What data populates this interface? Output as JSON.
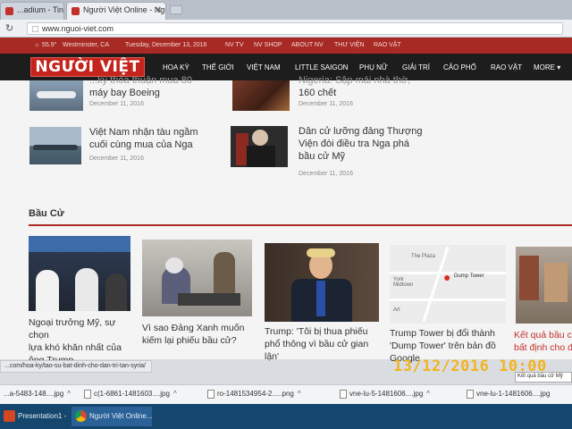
{
  "browser": {
    "tabs": [
      {
        "label": "...adium - Tin Ti..."
      },
      {
        "label": "Người Việt Online - Ngu..."
      }
    ],
    "url": "www.nguoi-viet.com"
  },
  "topbar": {
    "weather": "55.9°",
    "location": "Westminster, CA",
    "date": "Tuesday, December 13, 2016",
    "links": [
      "NV TV",
      "NV SHOP",
      "ABOUT NV",
      "THƯ VIỆN",
      "RAO VẶT"
    ]
  },
  "site": {
    "logo": "NGƯỜI VIỆT",
    "nav": [
      "HOA KỲ",
      "THẾ GIỚI",
      "VIỆT NAM",
      "LITTLE SAIGON",
      "PHỤ NỮ",
      "GIẢI TRÍ",
      "CẢO PHỐ",
      "RAO VẶT",
      "MORE ▾"
    ]
  },
  "top_stories": [
    {
      "title_partial": "...ký thỏa thuận mua 80",
      "title_line2": "máy bay Boeing",
      "date": "December 11, 2016"
    },
    {
      "title_partial": "Nigeria: Sập mái nhà thờ,",
      "title_line2": "160 chết",
      "date": "December 11, 2016"
    },
    {
      "title_line1": "Việt Nam nhận tàu ngầm",
      "title_line2": "cuối cùng mua của Nga",
      "date": "December 11, 2016"
    },
    {
      "title_line1": "Dân cử lưỡng đảng Thượng",
      "title_line2": "Viện đòi điều tra Nga phá",
      "title_line3": "bầu cử Mỹ",
      "date": "December 11, 2016"
    }
  ],
  "section": {
    "title": "Bầu Cử",
    "cards": [
      {
        "lines": [
          "Ngoại trưởng Mỹ, sự chọn",
          "lựa khó khăn nhất của",
          "ông Trump"
        ]
      },
      {
        "lines": [
          "Vì sao Đảng Xanh muốn",
          "kiếm lại phiếu bầu cử?"
        ]
      },
      {
        "lines": [
          "Trump: 'Tôi bị thua phiếu",
          "phổ thông vì bầu cử gian",
          "lận'"
        ]
      },
      {
        "lines": [
          "Trump Tower bị đổi thành",
          "'Dump Tower' trên bản đồ",
          "Google"
        ]
      },
      {
        "lines": [
          "Kết quả bầu cử",
          "bất định cho đ..."
        ]
      }
    ]
  },
  "map_labels": {
    "plaza": "The Plaza",
    "midtown": "York Midtown",
    "art": "Art",
    "pin": "Dump Tower"
  },
  "status_url": "...com/hoa-ky/tao-su-bat-dinh-cho-dan-tri-tan-syria/",
  "tooltip": "Kết quả bầu cử Mỹ",
  "photo_timestamp": "13/12/2016  10:00",
  "downloads": [
    {
      "name": "...a-5483-148....jpg"
    },
    {
      "name": "c(1-6861-1481603....jpg"
    },
    {
      "name": "ro-1481534954-2.....png"
    },
    {
      "name": "vne-lu-5-1481606....jpg"
    },
    {
      "name": "vne-lu-1-1481606....jpg"
    }
  ],
  "taskbar": [
    {
      "label": "Presentation1 - P..."
    },
    {
      "label": "Người Việt Online..."
    }
  ],
  "colors": {
    "brand_red": "#c4241d",
    "topbar_red": "#a82a24",
    "nav_dark": "#1d1d1d",
    "timestamp_orange": "#f2b31f",
    "taskbar_blue": "#14466e"
  }
}
